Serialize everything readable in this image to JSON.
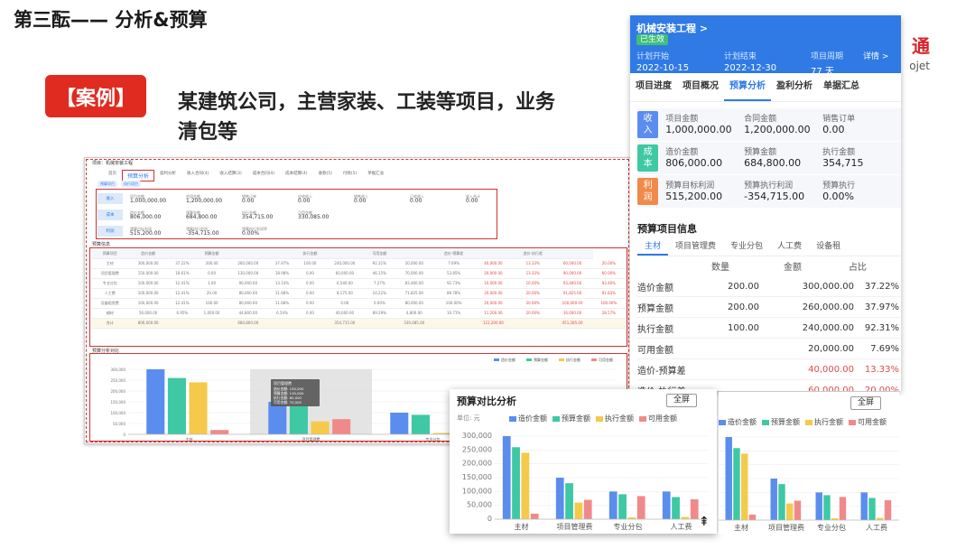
{
  "slide": {
    "title": "第三酝—— 分析&预算",
    "case_badge": "【案例】",
    "case_text_line1": "某建筑公司，主营家装、工装等项目，业务",
    "case_text_line2": "清包等",
    "brand_text": "通",
    "brand_sub": "ojet"
  },
  "colors": {
    "blue": "#5b8def",
    "green": "#3fc8a4",
    "yellow": "#f5c94c",
    "red": "#f08a8a",
    "accent": "#2f7ae5",
    "danger": "#e02b20"
  },
  "desktop": {
    "header": "项目：机械安装工程",
    "tabs": [
      "首页",
      "预算分析",
      "盈利分析",
      "收入合同(4)",
      "收入结算(3)",
      "成本合同(4)",
      "成本结算(4)",
      "收款(5)",
      "付款(5)",
      "单据汇总"
    ],
    "subtabs": [
      "预算项目",
      "执行项目"
    ],
    "summary": [
      {
        "tag": "收入",
        "cells": [
          {
            "label": "项目金额",
            "value": "1,000,000.00"
          },
          {
            "label": "合同金额",
            "value": "1,200,000.00"
          },
          {
            "label": "销售订单",
            "value": "0.00"
          },
          {
            "label": "应收收入",
            "value": "0.00"
          },
          {
            "label": "销售收入",
            "value": "0.00"
          },
          {
            "label": "已收收入",
            "value": "0.00"
          },
          {
            "label": "收入合计",
            "value": "0.00"
          }
        ]
      },
      {
        "tag": "成本",
        "cells": [
          {
            "label": "造价金额",
            "value": "806,000.00"
          },
          {
            "label": "预算金额",
            "value": "684,800.00"
          },
          {
            "label": "执行金额",
            "value": "354,715.00"
          },
          {
            "label": "可用金额",
            "value": "330,085.00"
          }
        ]
      },
      {
        "tag": "利润",
        "cells": [
          {
            "label": "预算目标利润",
            "value": "515,200.00"
          },
          {
            "label": "预算执行利润",
            "value": "-354,715.00"
          },
          {
            "label": "预算执行利润率",
            "value": "0.00%"
          }
        ]
      }
    ],
    "section_label": "预算信息",
    "table_header": [
      "预算项目",
      "造价金额",
      "",
      "预算金额",
      "",
      "",
      "执行金额",
      "",
      "可用金额",
      "",
      "造价-预算差",
      "",
      "造价-执行差",
      ""
    ],
    "table_rows": [
      [
        "主材",
        "300,000.00",
        "37.22%",
        "200.00",
        "260,000.00",
        "37.97%",
        "100.00",
        "240,000.00",
        "92.31%",
        "20,000.00",
        "7.69%",
        "40,000.00",
        "13.33%",
        "60,000.00",
        "20.00%"
      ],
      [
        "项目管理费",
        "150,000.00",
        "18.61%",
        "0.00",
        "130,000.00",
        "18.98%",
        "0.00",
        "60,000.00",
        "46.15%",
        "70,000.00",
        "53.85%",
        "20,000.00",
        "13.33%",
        "90,000.00",
        "60.00%"
      ],
      [
        "专业分包",
        "100,000.00",
        "12.41%",
        "1.00",
        "90,000.00",
        "13.14%",
        "0.00",
        "6,540.00",
        "7.27%",
        "83,460.00",
        "92.73%",
        "10,000.00",
        "10.00%",
        "93,460.00",
        "93.46%"
      ],
      [
        "人工费",
        "100,000.00",
        "12.41%",
        "20.00",
        "80,000.00",
        "11.68%",
        "0.00",
        "8,175.00",
        "10.22%",
        "71,825.00",
        "89.78%",
        "20,000.00",
        "20.00%",
        "91,825.00",
        "91.83%"
      ],
      [
        "设备租赁费",
        "100,000.00",
        "12.41%",
        "100.00",
        "80,000.00",
        "11.68%",
        "0.00",
        "0.00",
        "0.00%",
        "80,000.00",
        "100.00%",
        "20,000.00",
        "20.00%",
        "100,000.00",
        "100.00%"
      ],
      [
        "辅材",
        "56,000.00",
        "6.95%",
        "1,000.00",
        "44,800.00",
        "6.54%",
        "0.00",
        "40,000.00",
        "89.29%",
        "4,800.00",
        "10.71%",
        "11,200.00",
        "20.00%",
        "16,000.00",
        "28.57%"
      ],
      [
        "合计",
        "806,000.00",
        "",
        "",
        "684,800.00",
        "",
        "",
        "354,715.00",
        "",
        "330,085.00",
        "",
        "121,200.00",
        "",
        "451,285.00",
        ""
      ]
    ],
    "chart_title": "预算分析对比",
    "chart_legend": [
      "造价金额",
      "预算金额",
      "执行金额",
      "可用金额"
    ],
    "chart_ylabels": [
      "300,000",
      "250,000",
      "200,000",
      "150,000",
      "100,000",
      "50,000",
      "0"
    ],
    "chart_categories": [
      "主材",
      "项目管理费",
      "专业分包",
      "人工费"
    ],
    "tooltip": {
      "title": "项目管理费",
      "lines": [
        "造价金额: 150,000",
        "预算金额: 130,000",
        "执行金额: 60,000",
        "可用金额: 70,000"
      ]
    }
  },
  "mobile": {
    "title": "机械安装工程 >",
    "status": "已生效",
    "plan_start_label": "计划开始",
    "plan_start": "2022-10-15",
    "plan_end_label": "计划结束",
    "plan_end": "2022-12-30",
    "period_label": "项目周期",
    "period": "77 天",
    "detail": "详情 >",
    "tabs": [
      "项目进度",
      "项目概况",
      "预算分析",
      "盈利分析",
      "单据汇总"
    ],
    "rows": [
      {
        "tag": [
          "收",
          "入"
        ],
        "color": "#5b8def",
        "cols": [
          {
            "label": "项目金额",
            "value": "1,000,000.00"
          },
          {
            "label": "合同金额",
            "value": "1,200,000.00"
          },
          {
            "label": "销售订单",
            "value": "0.00"
          }
        ]
      },
      {
        "tag": [
          "成",
          "本"
        ],
        "color": "#3fc8a4",
        "cols": [
          {
            "label": "造价金额",
            "value": "806,000.00"
          },
          {
            "label": "预算金额",
            "value": "684,800.00"
          },
          {
            "label": "执行金额",
            "value": "354,715"
          }
        ]
      },
      {
        "tag": [
          "利",
          "润"
        ],
        "color": "#f08a4a",
        "cols": [
          {
            "label": "预算目标利润",
            "value": "515,200.00"
          },
          {
            "label": "预算执行利润",
            "value": "-354,715.00"
          },
          {
            "label": "预算执行",
            "value": "0.00%"
          }
        ]
      }
    ],
    "section_title": "预算项目信息",
    "subtabs": [
      "主材",
      "项目管理费",
      "专业分包",
      "人工费",
      "设备租"
    ],
    "header": [
      "数量",
      "金额",
      "占比"
    ],
    "lines": [
      {
        "name": "造价金额",
        "qty": "200.00",
        "amount": "300,000.00",
        "ratio": "37.22%",
        "red": false
      },
      {
        "name": "预算金额",
        "qty": "200.00",
        "amount": "260,000.00",
        "ratio": "37.97%",
        "red": false
      },
      {
        "name": "执行金额",
        "qty": "100.00",
        "amount": "240,000.00",
        "ratio": "92.31%",
        "red": false
      },
      {
        "name": "可用金额",
        "qty": "",
        "amount": "20,000.00",
        "ratio": "7.69%",
        "red": false
      },
      {
        "name": "造价-预算差",
        "qty": "",
        "amount": "40,000.00",
        "ratio": "13.33%",
        "red": true
      },
      {
        "name": "造价-执行差",
        "qty": "",
        "amount": "60,000.00",
        "ratio": "20.00%",
        "red": true
      }
    ]
  },
  "chart_card": {
    "title": "预算对比分析",
    "fullscreen": "全屏",
    "unit": "单位: 元",
    "legend": [
      "造价金额",
      "预算金额",
      "执行金额",
      "可用金额"
    ]
  },
  "chart_card2": {
    "fullscreen": "全屏"
  },
  "chart_data": {
    "type": "bar",
    "categories": [
      "主材",
      "项目管理费",
      "专业分包",
      "人工费"
    ],
    "series": [
      {
        "name": "造价金额",
        "values": [
          300000,
          150000,
          100000,
          100000
        ]
      },
      {
        "name": "预算金额",
        "values": [
          260000,
          130000,
          90000,
          80000
        ]
      },
      {
        "name": "执行金额",
        "values": [
          240000,
          60000,
          6540,
          8175
        ]
      },
      {
        "name": "可用金额",
        "values": [
          20000,
          70000,
          83460,
          71825
        ]
      }
    ],
    "yticks": [
      "0",
      "50,000",
      "100,000",
      "150,000",
      "200,000",
      "250,000",
      "300,000"
    ],
    "ylim": [
      0,
      300000
    ],
    "legend_position": "top-right"
  }
}
